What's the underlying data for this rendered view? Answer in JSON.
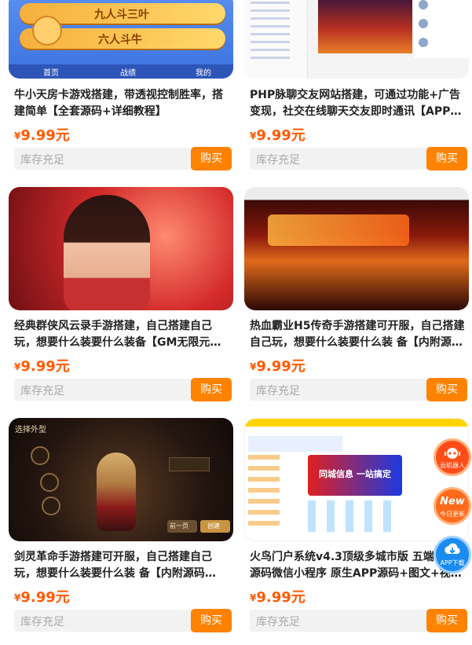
{
  "products": [
    {
      "title": "牛小天房卡游戏搭建，带透视控制胜率，搭建简单【全套源码+详细教程】",
      "currency": "¥",
      "price": "9.99元",
      "stock": "库存充足",
      "buy": "购买",
      "image_text": {
        "banner1": "九人斗三叶",
        "banner2": "六人斗牛",
        "nav": [
          "首页",
          "战绩",
          "我的"
        ]
      }
    },
    {
      "title": "PHP脉聊交友网站搭建，可通过功能+广告变现，社交在线聊天交友即时通讯【APP源码…",
      "currency": "¥",
      "price": "9.99元",
      "stock": "库存充足",
      "buy": "购买"
    },
    {
      "title": "经典群侠风云录手游搭建，自己搭建自己玩，想要什么装要什么装备【GM无限元宝+全…",
      "currency": "¥",
      "price": "9.99元",
      "stock": "库存充足",
      "buy": "购买"
    },
    {
      "title": "热血霸业H5传奇手游搭建可开服，自己搭建自己玩，想要什么装要什么装 备【内附源…",
      "currency": "¥",
      "price": "9.99元",
      "stock": "库存充足",
      "buy": "购买"
    },
    {
      "title": "剑灵革命手游搭建可开服，自己搭建自己玩，想要什么装要什么装 备【内附源码+GM+…",
      "currency": "¥",
      "price": "9.99元",
      "stock": "库存充足",
      "buy": "购买",
      "image_text": {
        "header": "选择外型",
        "prev": "前一页",
        "confirm": "创建"
      }
    },
    {
      "title": "火鸟门户系统v4.3顶级多城市版 五端全开源码微信小程序 原生APP源码+图文+视频教…",
      "currency": "¥",
      "price": "9.99元",
      "stock": "库存充足",
      "buy": "购买",
      "image_text": {
        "banner": "同城信息 一站搞定"
      }
    }
  ],
  "floating": [
    {
      "label": "云机器人",
      "icon": "robot-icon"
    },
    {
      "label": "今日更新",
      "badge": "New",
      "icon": "new-badge-icon"
    },
    {
      "label": "APP下载",
      "icon": "cloud-download-icon"
    }
  ],
  "colors": {
    "price": "#ff5a00",
    "buy": "#ff8200",
    "stock_bg": "#f2f2f2"
  }
}
